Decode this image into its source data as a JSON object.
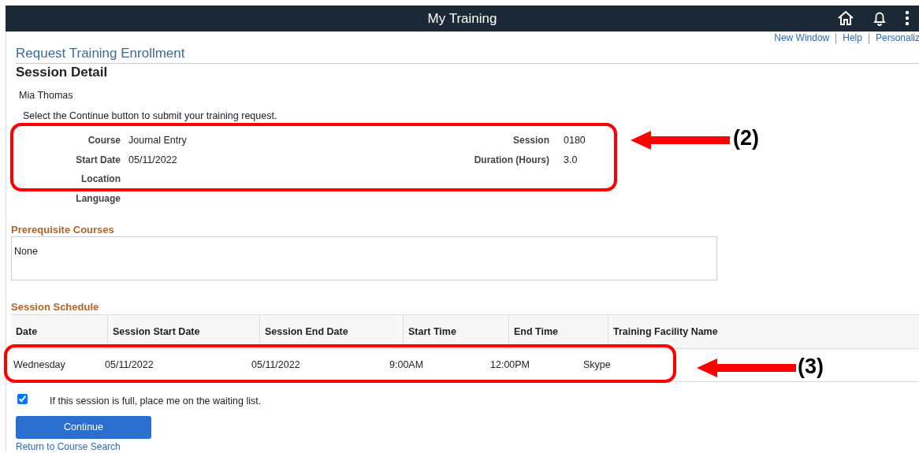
{
  "header": {
    "title": "My Training"
  },
  "top_links": [
    "New Window",
    "Help",
    "Personaliz"
  ],
  "page_title": "Request Training Enrollment",
  "section_title": "Session Detail",
  "person_name": "Mia Thomas",
  "instruction": "Select the Continue button to submit your training request.",
  "details_left": [
    {
      "label": "Course",
      "value": "Journal Entry"
    },
    {
      "label": "Start Date",
      "value": "05/11/2022"
    },
    {
      "label": "Location"
    },
    {
      "label": "Language"
    }
  ],
  "details_right": [
    {
      "label": "Session",
      "value": "0180"
    },
    {
      "label": "Duration (Hours)",
      "value": "3.0"
    }
  ],
  "prerequisites": {
    "title": "Prerequisite Courses",
    "value": "None"
  },
  "schedule": {
    "title": "Session Schedule",
    "columns": [
      "Date",
      "Session Start Date",
      "Session End Date",
      "Start Time",
      "End Time",
      "Training Facility Name"
    ],
    "rows": [
      [
        "Wednesday",
        "05/11/2022",
        "05/11/2022",
        "9:00AM",
        "12:00PM",
        "Skype"
      ]
    ]
  },
  "waitlist": {
    "checked": true,
    "label": "If this session is full, place me on the waiting list."
  },
  "continue_button": "Continue",
  "return_link": "Return to Course Search",
  "annotations": [
    {
      "label": "(2)"
    },
    {
      "label": "(3)"
    }
  ]
}
